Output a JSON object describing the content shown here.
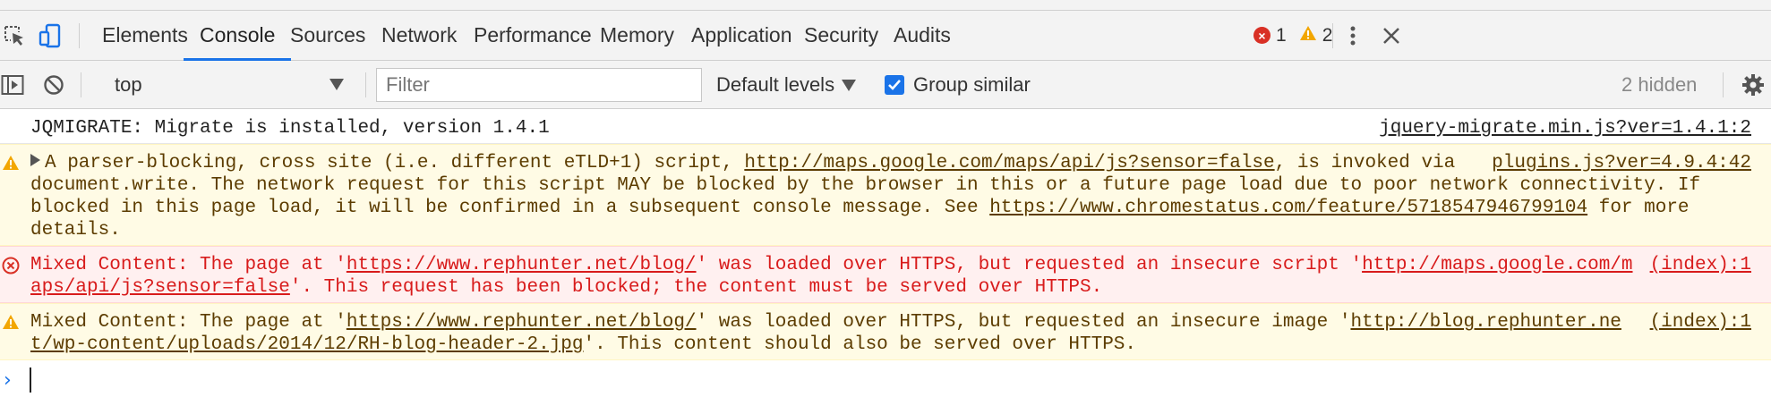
{
  "tabs": [
    {
      "label": "Elements"
    },
    {
      "label": "Console"
    },
    {
      "label": "Sources"
    },
    {
      "label": "Network"
    },
    {
      "label": "Performance"
    },
    {
      "label": "Memory"
    },
    {
      "label": "Application"
    },
    {
      "label": "Security"
    },
    {
      "label": "Audits"
    }
  ],
  "active_tab": "Console",
  "counts": {
    "errors": "1",
    "warnings": "2"
  },
  "filterbar": {
    "context": "top",
    "filter_placeholder": "Filter",
    "levels": "Default levels",
    "group_similar": "Group similar",
    "hidden": "2 hidden"
  },
  "messages": [
    {
      "level": "info",
      "source": "jquery-migrate.min.js?ver=1.4.1:2",
      "text": "JQMIGRATE: Migrate is installed, version 1.4.1"
    },
    {
      "level": "warning",
      "source": "plugins.js?ver=4.9.4:42",
      "t1": "A parser-blocking, cross site (i.e. different eTLD+1) script, ",
      "link1": "http://maps.google.com/maps/api/js?sensor=false",
      "t2": ", is invoked via document.write. The network request for this script MAY be blocked by the browser in this or a future page load due to poor network connectivity. If blocked in this page load, it will be confirmed in a subsequent console message. See ",
      "link2": "https://www.chromestatus.com/feature/5718547946799104",
      "t3": " for more details."
    },
    {
      "level": "error",
      "source": "(index):1",
      "t1": "Mixed Content: The page at '",
      "link1": "https://www.rephunter.net/blog/",
      "t2": "' was loaded over HTTPS, but requested an insecure script '",
      "link2": "http://maps.google.com/maps/api/js?sensor=false",
      "t3": "'. This request has been blocked; the content must be served over HTTPS."
    },
    {
      "level": "warning",
      "source": "(index):1",
      "t1": "Mixed Content: The page at '",
      "link1": "https://www.rephunter.net/blog/",
      "t2": "' was loaded over HTTPS, but requested an insecure image '",
      "link2": "http://blog.rephunter.net/wp-content/uploads/2014/12/RH-blog-header-2.jpg",
      "t3": "'. This content should also be served over HTTPS."
    }
  ],
  "icons": {
    "inspect": "cursor-arrow-icon",
    "device": "device-toggle-icon",
    "more": "vertical-dots-icon",
    "close": "close-x-icon",
    "sidebar": "sidebar-toggle-icon",
    "clear": "clear-console-icon",
    "settings": "gear-icon"
  },
  "colors": {
    "accent": "#1a73e8",
    "error": "#d93025",
    "warning": "#f2a600"
  }
}
